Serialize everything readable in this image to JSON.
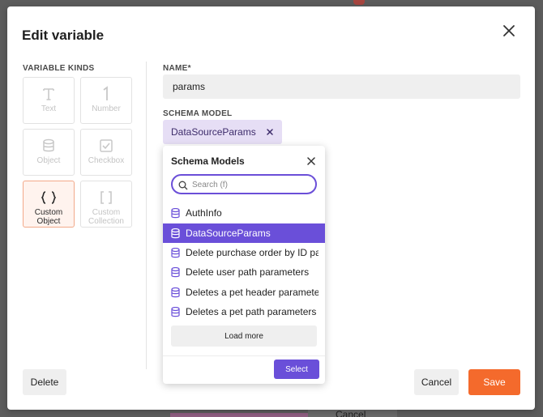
{
  "modal": {
    "title": "Edit variable"
  },
  "kinds": {
    "title": "VARIABLE KINDS",
    "items": [
      {
        "label": "Text",
        "icon": "text-icon",
        "selected": false
      },
      {
        "label": "Number",
        "icon": "number-icon",
        "selected": false
      },
      {
        "label": "Object",
        "icon": "database-icon",
        "selected": false
      },
      {
        "label": "Checkbox",
        "icon": "checkbox-icon",
        "selected": false
      },
      {
        "label": "Custom Object",
        "icon": "braces-icon",
        "selected": true
      },
      {
        "label": "Custom Collection",
        "icon": "brackets-icon",
        "selected": false
      }
    ]
  },
  "name_field": {
    "label": "NAME*",
    "value": "params"
  },
  "schema_field": {
    "label": "SCHEMA MODEL",
    "chip_label": "DataSourceParams"
  },
  "dropdown": {
    "title": "Schema Models",
    "search_placeholder": "Search (f)",
    "items": [
      {
        "label": "AuthInfo",
        "active": false
      },
      {
        "label": "DataSourceParams",
        "active": true
      },
      {
        "label": "Delete purchase order by ID pa...",
        "active": false
      },
      {
        "label": "Delete user path parameters",
        "active": false
      },
      {
        "label": "Deletes a pet header parameters",
        "active": false
      },
      {
        "label": "Deletes a pet path parameters",
        "active": false
      }
    ],
    "load_more_label": "Load more",
    "select_label": "Select"
  },
  "footer": {
    "delete_label": "Delete",
    "cancel_label": "Cancel",
    "save_label": "Save"
  },
  "colors": {
    "accent_purple": "#6a4fd9",
    "save_orange": "#f46a2c",
    "chip_bg": "#e6def5",
    "selected_kind_border": "#f2a98a"
  },
  "backdrop": {
    "bottom_text": "Cancel"
  }
}
